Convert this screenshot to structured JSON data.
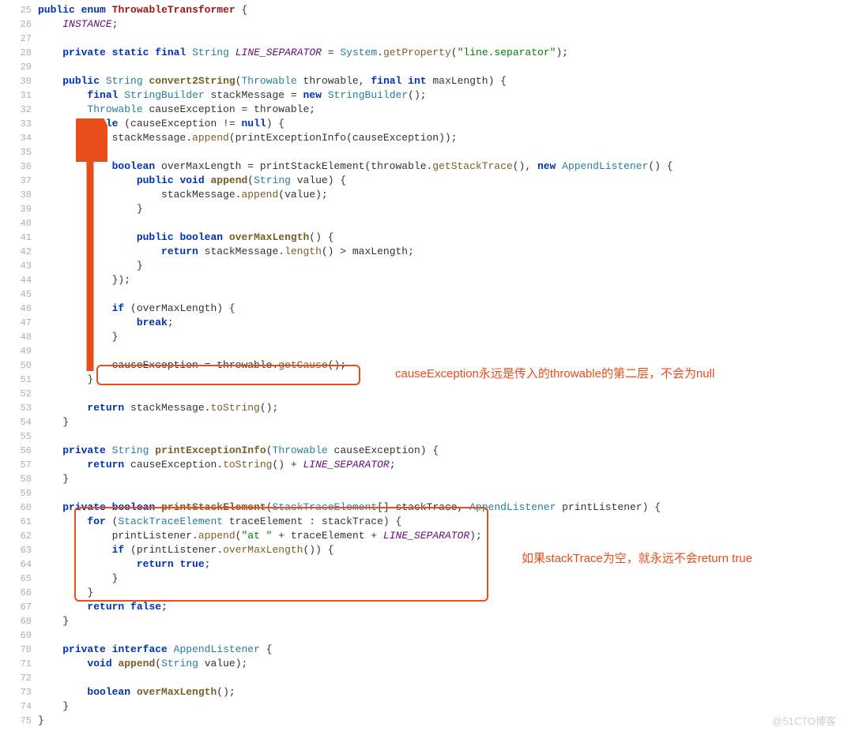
{
  "startLine": 25,
  "endLine": 75,
  "annotations": {
    "ann1": "causeException永远是传入的throwable的第二层，不会为null",
    "ann2": "如果stackTrace为空，就永远不会return true"
  },
  "watermark": "@51CTO博客",
  "code": {
    "l25": {
      "pre": "",
      "tokens": [
        [
          "kw",
          "public"
        ],
        [
          "",
          " "
        ],
        [
          "kw",
          "enum"
        ],
        [
          "",
          " "
        ],
        [
          "enumname",
          "ThrowableTransformer"
        ],
        [
          "",
          " {"
        ]
      ]
    },
    "l26": {
      "pre": "    ",
      "tokens": [
        [
          "purple-italic",
          "INSTANCE"
        ],
        [
          "",
          ";"
        ]
      ]
    },
    "l27": {
      "pre": "",
      "tokens": [
        [
          "",
          ""
        ]
      ]
    },
    "l28": {
      "pre": "    ",
      "tokens": [
        [
          "kw",
          "private"
        ],
        [
          "",
          " "
        ],
        [
          "kw",
          "static"
        ],
        [
          "",
          " "
        ],
        [
          "kw",
          "final"
        ],
        [
          "",
          " "
        ],
        [
          "type",
          "String"
        ],
        [
          "",
          " "
        ],
        [
          "purple-italic",
          "LINE_SEPARATOR"
        ],
        [
          "",
          " = "
        ],
        [
          "type",
          "System"
        ],
        [
          "",
          ".",
          ""
        ],
        [
          "call",
          "getProperty"
        ],
        [
          "",
          "("
        ],
        [
          "str",
          "\"line.separator\""
        ],
        [
          "",
          ");"
        ]
      ]
    },
    "l29": {
      "pre": "",
      "tokens": [
        [
          "",
          ""
        ]
      ]
    },
    "l30": {
      "pre": "    ",
      "tokens": [
        [
          "kw",
          "public"
        ],
        [
          "",
          " "
        ],
        [
          "type",
          "String"
        ],
        [
          "",
          " "
        ],
        [
          "decl",
          "convert2String"
        ],
        [
          "",
          "("
        ],
        [
          "type",
          "Throwable"
        ],
        [
          "",
          " throwable, "
        ],
        [
          "kw",
          "final"
        ],
        [
          "",
          " "
        ],
        [
          "kw",
          "int"
        ],
        [
          "",
          " maxLength) {"
        ]
      ]
    },
    "l31": {
      "pre": "        ",
      "tokens": [
        [
          "kw",
          "final"
        ],
        [
          "",
          " "
        ],
        [
          "type",
          "StringBuilder"
        ],
        [
          "",
          " stackMessage = "
        ],
        [
          "kw",
          "new"
        ],
        [
          "",
          " "
        ],
        [
          "type",
          "StringBuilder"
        ],
        [
          "",
          "();"
        ]
      ]
    },
    "l32": {
      "pre": "        ",
      "tokens": [
        [
          "type",
          "Throwable"
        ],
        [
          "",
          " causeException = throwable;"
        ]
      ]
    },
    "l33": {
      "pre": "        ",
      "tokens": [
        [
          "kw",
          "while"
        ],
        [
          "",
          " (causeException != "
        ],
        [
          "kw",
          "null"
        ],
        [
          "",
          ") {"
        ]
      ]
    },
    "l34": {
      "pre": "            ",
      "tokens": [
        [
          "",
          "stackMessage."
        ],
        [
          "call",
          "append"
        ],
        [
          "",
          "(printExceptionInfo(causeException));"
        ]
      ]
    },
    "l35": {
      "pre": "",
      "tokens": [
        [
          "",
          ""
        ]
      ]
    },
    "l36": {
      "pre": "            ",
      "tokens": [
        [
          "kw",
          "boolean"
        ],
        [
          "",
          " overMaxLength = printStackElement(throwable."
        ],
        [
          "call",
          "getStackTrace"
        ],
        [
          "",
          "(), "
        ],
        [
          "kw",
          "new"
        ],
        [
          "",
          " "
        ],
        [
          "type",
          "AppendListener"
        ],
        [
          "",
          "() {"
        ]
      ]
    },
    "l37": {
      "pre": "                ",
      "tokens": [
        [
          "kw",
          "public"
        ],
        [
          "",
          " "
        ],
        [
          "kw",
          "void"
        ],
        [
          "",
          " "
        ],
        [
          "decl",
          "append"
        ],
        [
          "",
          "("
        ],
        [
          "type",
          "String"
        ],
        [
          "",
          " value) {"
        ]
      ]
    },
    "l38": {
      "pre": "                    ",
      "tokens": [
        [
          "",
          "stackMessage."
        ],
        [
          "call",
          "append"
        ],
        [
          "",
          "(value);"
        ]
      ]
    },
    "l39": {
      "pre": "                ",
      "tokens": [
        [
          "",
          "}"
        ]
      ]
    },
    "l40": {
      "pre": "",
      "tokens": [
        [
          "",
          ""
        ]
      ]
    },
    "l41": {
      "pre": "                ",
      "tokens": [
        [
          "kw",
          "public"
        ],
        [
          "",
          " "
        ],
        [
          "kw",
          "boolean"
        ],
        [
          "",
          " "
        ],
        [
          "decl",
          "overMaxLength"
        ],
        [
          "",
          "() {"
        ]
      ]
    },
    "l42": {
      "pre": "                    ",
      "tokens": [
        [
          "kw",
          "return"
        ],
        [
          "",
          " stackMessage."
        ],
        [
          "call",
          "length"
        ],
        [
          "",
          "() > maxLength;"
        ]
      ]
    },
    "l43": {
      "pre": "                ",
      "tokens": [
        [
          "",
          "}"
        ]
      ]
    },
    "l44": {
      "pre": "            ",
      "tokens": [
        [
          "",
          "});"
        ]
      ]
    },
    "l45": {
      "pre": "",
      "tokens": [
        [
          "",
          ""
        ]
      ]
    },
    "l46": {
      "pre": "            ",
      "tokens": [
        [
          "kw",
          "if"
        ],
        [
          "",
          " (overMaxLength) {"
        ]
      ]
    },
    "l47": {
      "pre": "                ",
      "tokens": [
        [
          "kw",
          "break"
        ],
        [
          "",
          ";"
        ]
      ]
    },
    "l48": {
      "pre": "            ",
      "tokens": [
        [
          "",
          "}"
        ]
      ]
    },
    "l49": {
      "pre": "",
      "tokens": [
        [
          "",
          ""
        ]
      ]
    },
    "l50": {
      "pre": "            ",
      "tokens": [
        [
          "",
          "causeException = throwable."
        ],
        [
          "call",
          "getCause"
        ],
        [
          "",
          "();"
        ]
      ]
    },
    "l51": {
      "pre": "        ",
      "tokens": [
        [
          "",
          "}"
        ]
      ]
    },
    "l52": {
      "pre": "",
      "tokens": [
        [
          "",
          ""
        ]
      ]
    },
    "l53": {
      "pre": "        ",
      "tokens": [
        [
          "kw",
          "return"
        ],
        [
          "",
          " stackMessage."
        ],
        [
          "call",
          "toString"
        ],
        [
          "",
          "();"
        ]
      ]
    },
    "l54": {
      "pre": "    ",
      "tokens": [
        [
          "",
          "}"
        ]
      ]
    },
    "l55": {
      "pre": "",
      "tokens": [
        [
          "",
          ""
        ]
      ]
    },
    "l56": {
      "pre": "    ",
      "tokens": [
        [
          "kw",
          "private"
        ],
        [
          "",
          " "
        ],
        [
          "type",
          "String"
        ],
        [
          "",
          " "
        ],
        [
          "decl",
          "printExceptionInfo"
        ],
        [
          "",
          "("
        ],
        [
          "type",
          "Throwable"
        ],
        [
          "",
          " causeException) {"
        ]
      ]
    },
    "l57": {
      "pre": "        ",
      "tokens": [
        [
          "kw",
          "return"
        ],
        [
          "",
          " causeException."
        ],
        [
          "call",
          "toString"
        ],
        [
          "",
          "() + "
        ],
        [
          "purple-italic",
          "LINE_SEPARATOR"
        ],
        [
          "",
          ";"
        ]
      ]
    },
    "l58": {
      "pre": "    ",
      "tokens": [
        [
          "",
          "}"
        ]
      ]
    },
    "l59": {
      "pre": "",
      "tokens": [
        [
          "",
          ""
        ]
      ]
    },
    "l60": {
      "pre": "    ",
      "tokens": [
        [
          "kw",
          "private"
        ],
        [
          "",
          " "
        ],
        [
          "kw",
          "boolean"
        ],
        [
          "",
          " "
        ],
        [
          "decl",
          "printStackElement"
        ],
        [
          "",
          "("
        ],
        [
          "type",
          "StackTraceElement"
        ],
        [
          "",
          "[] stackTrace, "
        ],
        [
          "type",
          "AppendListener"
        ],
        [
          "",
          " printListener) {"
        ]
      ]
    },
    "l61": {
      "pre": "        ",
      "tokens": [
        [
          "kw",
          "for"
        ],
        [
          "",
          " ("
        ],
        [
          "type",
          "StackTraceElement"
        ],
        [
          "",
          " traceElement : stackTrace) {"
        ]
      ]
    },
    "l62": {
      "pre": "            ",
      "tokens": [
        [
          "",
          "printListener."
        ],
        [
          "call",
          "append"
        ],
        [
          "",
          "("
        ],
        [
          "str",
          "\"at \""
        ],
        [
          "",
          " + traceElement + "
        ],
        [
          "purple-italic",
          "LINE_SEPARATOR"
        ],
        [
          "",
          ");"
        ]
      ]
    },
    "l63": {
      "pre": "            ",
      "tokens": [
        [
          "kw",
          "if"
        ],
        [
          "",
          " (printListener."
        ],
        [
          "call",
          "overMaxLength"
        ],
        [
          "",
          "()) {"
        ]
      ]
    },
    "l64": {
      "pre": "                ",
      "tokens": [
        [
          "kw",
          "return"
        ],
        [
          "",
          " "
        ],
        [
          "kw",
          "true"
        ],
        [
          "",
          ";"
        ]
      ]
    },
    "l65": {
      "pre": "            ",
      "tokens": [
        [
          "",
          "}"
        ]
      ]
    },
    "l66": {
      "pre": "        ",
      "tokens": [
        [
          "",
          "}"
        ]
      ]
    },
    "l67": {
      "pre": "        ",
      "tokens": [
        [
          "kw",
          "return"
        ],
        [
          "",
          " "
        ],
        [
          "kw",
          "false"
        ],
        [
          "",
          ";"
        ]
      ]
    },
    "l68": {
      "pre": "    ",
      "tokens": [
        [
          "",
          "}"
        ]
      ]
    },
    "l69": {
      "pre": "",
      "tokens": [
        [
          "",
          ""
        ]
      ]
    },
    "l70": {
      "pre": "    ",
      "tokens": [
        [
          "kw",
          "private"
        ],
        [
          "",
          " "
        ],
        [
          "kw",
          "interface"
        ],
        [
          "",
          " "
        ],
        [
          "type",
          "AppendListener"
        ],
        [
          "",
          " {"
        ]
      ]
    },
    "l71": {
      "pre": "        ",
      "tokens": [
        [
          "kw",
          "void"
        ],
        [
          "",
          " "
        ],
        [
          "decl",
          "append"
        ],
        [
          "",
          "("
        ],
        [
          "type",
          "String"
        ],
        [
          "",
          " value);"
        ]
      ]
    },
    "l72": {
      "pre": "",
      "tokens": [
        [
          "",
          ""
        ]
      ]
    },
    "l73": {
      "pre": "        ",
      "tokens": [
        [
          "kw",
          "boolean"
        ],
        [
          "",
          " "
        ],
        [
          "decl",
          "overMaxLength"
        ],
        [
          "",
          "();"
        ]
      ]
    },
    "l74": {
      "pre": "    ",
      "tokens": [
        [
          "",
          "}"
        ]
      ]
    },
    "l75": {
      "pre": "",
      "tokens": [
        [
          "",
          "}"
        ]
      ]
    }
  }
}
